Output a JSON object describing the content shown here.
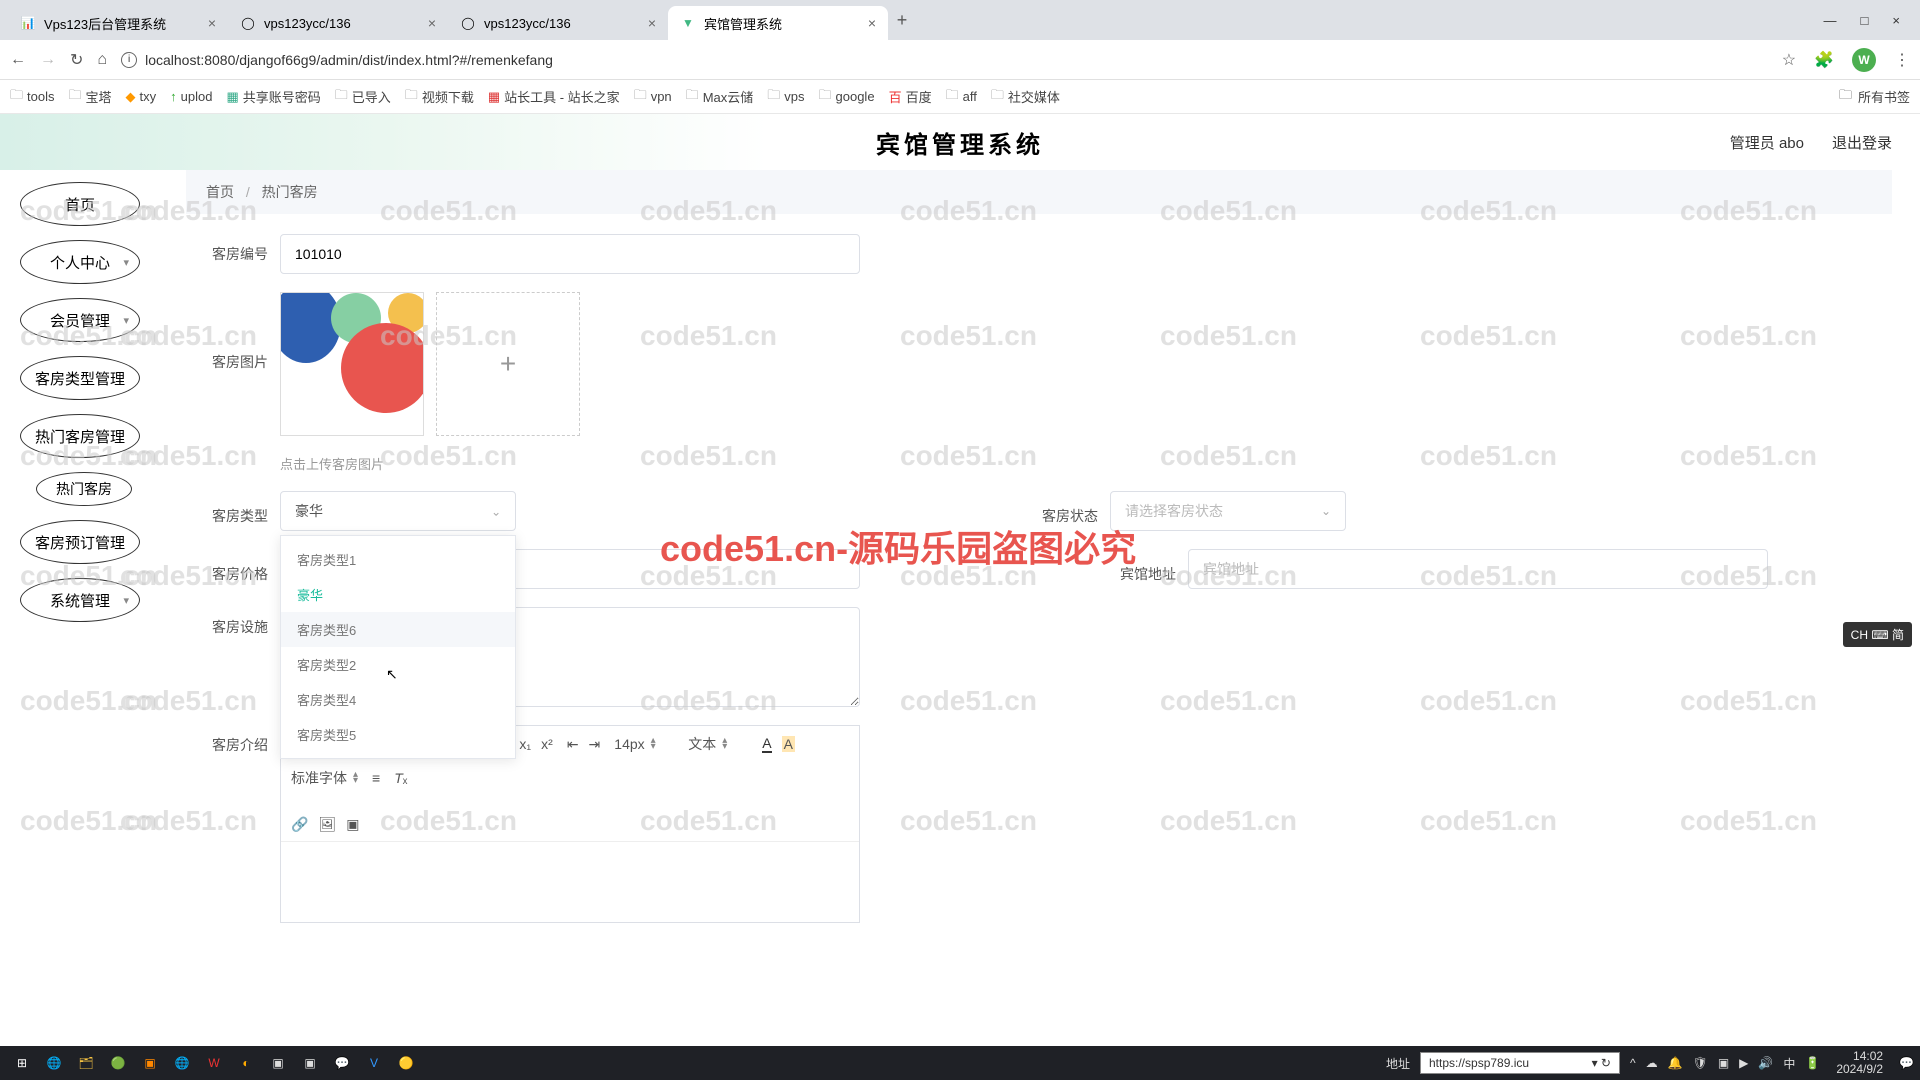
{
  "browser": {
    "tabs": [
      {
        "title": "Vps123后台管理系统"
      },
      {
        "title": "vps123ycc/136"
      },
      {
        "title": "vps123ycc/136"
      },
      {
        "title": "宾馆管理系统"
      }
    ],
    "url": "localhost:8080/djangof66g9/admin/dist/index.html?#/remenkefang",
    "avatar_letter": "W"
  },
  "bookmarks": [
    "tools",
    "宝塔",
    "txy",
    "uplod",
    "共享账号密码",
    "已导入",
    "视频下载",
    "站长工具 - 站长之家",
    "vpn",
    "Max云储",
    "vps",
    "google",
    "百度",
    "aff",
    "社交媒体"
  ],
  "bookmark_right": "所有书签",
  "app": {
    "title": "宾馆管理系统",
    "admin_label": "管理员 abo",
    "logout": "退出登录"
  },
  "sidebar": {
    "items": [
      "首页",
      "个人中心",
      "会员管理",
      "客房类型管理",
      "热门客房管理",
      "客房预订管理",
      "系统管理"
    ],
    "sub_item": "热门客房"
  },
  "breadcrumb": {
    "home": "首页",
    "current": "热门客房"
  },
  "form": {
    "room_no_label": "客房编号",
    "room_no_value": "101010",
    "room_img_label": "客房图片",
    "upload_hint": "点击上传客房图片",
    "room_type_label": "客房类型",
    "room_type_value": "豪华",
    "room_status_label": "客房状态",
    "room_status_placeholder": "请选择客房状态",
    "room_price_label": "客房价格",
    "hotel_addr_label": "宾馆地址",
    "hotel_addr_placeholder": "宾馆地址",
    "room_facility_label": "客房设施",
    "room_intro_label": "客房介绍"
  },
  "dropdown_options": [
    "客房类型1",
    "豪华",
    "客房类型6",
    "客房类型2",
    "客房类型4",
    "客房类型5"
  ],
  "editor": {
    "font_size": "14px",
    "text_label": "文本",
    "font_family": "标准字体"
  },
  "taskbar": {
    "addr_label": "地址",
    "url": "https://spsp789.icu",
    "time": "14:02",
    "date": "2024/9/2"
  },
  "ime": "CH ⌨ 简",
  "watermark_text": "code51.cn",
  "watermark_big": "code51.cn-源码乐园盗图必究"
}
